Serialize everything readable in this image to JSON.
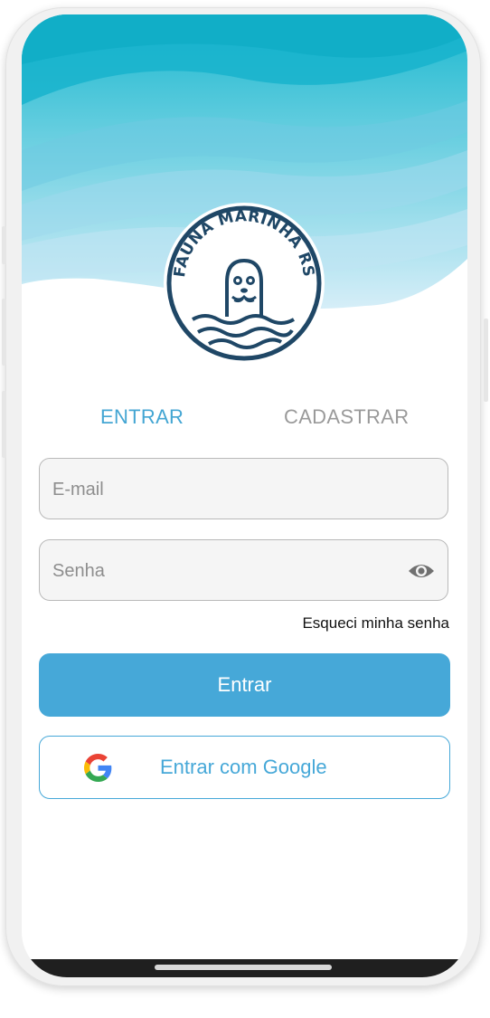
{
  "logo": {
    "text": "FAUNA MARINHA RS"
  },
  "tabs": [
    {
      "label": "ENTRAR",
      "active": true
    },
    {
      "label": "CADASTRAR",
      "active": false
    }
  ],
  "form": {
    "email": {
      "placeholder": "E-mail",
      "value": ""
    },
    "password": {
      "placeholder": "Senha",
      "value": ""
    },
    "forgot_label": "Esqueci minha senha",
    "submit_label": "Entrar",
    "google_label": "Entrar com Google"
  },
  "icons": {
    "password_toggle": "eye-icon",
    "google": "google-g-icon"
  },
  "colors": {
    "accent": "#46a8d8",
    "tab_active": "#44a6d3",
    "tab_inactive": "#9a9a9a",
    "logo_navy": "#1f4766",
    "wave_dark": "#1ab8cf",
    "wave_light": "#cfeaf5"
  }
}
